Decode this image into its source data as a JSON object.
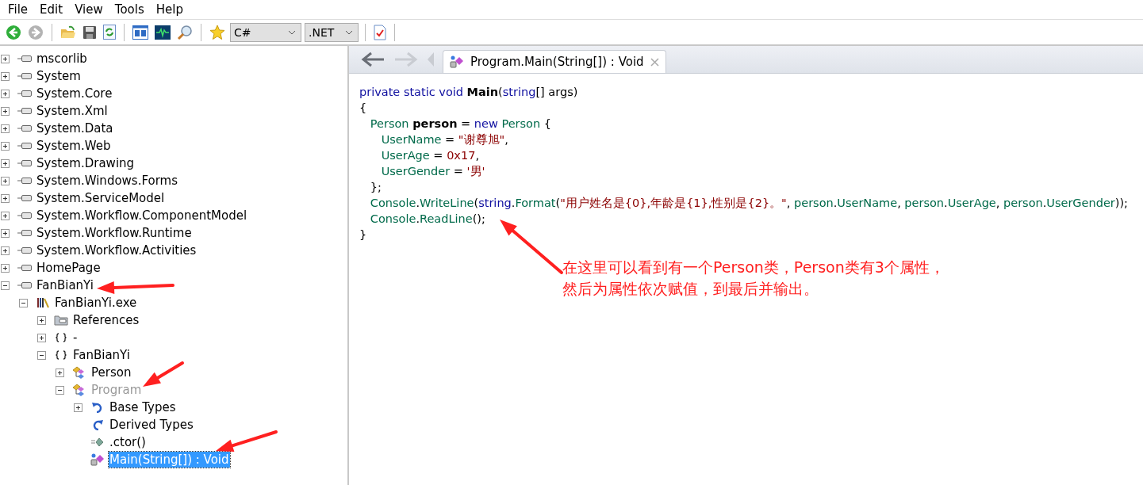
{
  "menu": [
    {
      "label": "File"
    },
    {
      "label": "Edit"
    },
    {
      "label": "View"
    },
    {
      "label": "Tools"
    },
    {
      "label": "Help"
    }
  ],
  "toolbar": {
    "buttons": [
      {
        "kind": "back",
        "disabled": false
      },
      {
        "kind": "forward",
        "disabled": true
      },
      {
        "kind": "sep"
      },
      {
        "kind": "open",
        "disabled": false
      },
      {
        "kind": "save",
        "disabled": false
      },
      {
        "kind": "reload",
        "disabled": false
      },
      {
        "kind": "sep"
      },
      {
        "kind": "text",
        "disabled": false
      },
      {
        "kind": "ildasm",
        "disabled": false
      },
      {
        "kind": "search",
        "disabled": false
      },
      {
        "kind": "sep"
      },
      {
        "kind": "favorite",
        "disabled": false
      }
    ],
    "language": "C#",
    "version": ".NET",
    "after": [
      {
        "kind": "sep"
      },
      {
        "kind": "check",
        "disabled": false
      },
      {
        "kind": "sep"
      }
    ]
  },
  "tree": [
    {
      "label": "mscorlib",
      "kind": "assembly",
      "expanded": false,
      "selected": false,
      "greyed": false
    },
    {
      "label": "System",
      "kind": "assembly",
      "expanded": false,
      "selected": false,
      "greyed": false
    },
    {
      "label": "System.Core",
      "kind": "assembly",
      "expanded": false,
      "selected": false,
      "greyed": false
    },
    {
      "label": "System.Xml",
      "kind": "assembly",
      "expanded": false,
      "selected": false,
      "greyed": false
    },
    {
      "label": "System.Data",
      "kind": "assembly",
      "expanded": false,
      "selected": false,
      "greyed": false
    },
    {
      "label": "System.Web",
      "kind": "assembly",
      "expanded": false,
      "selected": false,
      "greyed": false
    },
    {
      "label": "System.Drawing",
      "kind": "assembly",
      "expanded": false,
      "selected": false,
      "greyed": false
    },
    {
      "label": "System.Windows.Forms",
      "kind": "assembly",
      "expanded": false,
      "selected": false,
      "greyed": false
    },
    {
      "label": "System.ServiceModel",
      "kind": "assembly",
      "expanded": false,
      "selected": false,
      "greyed": false
    },
    {
      "label": "System.Workflow.ComponentModel",
      "kind": "assembly",
      "expanded": false,
      "selected": false,
      "greyed": false
    },
    {
      "label": "System.Workflow.Runtime",
      "kind": "assembly",
      "expanded": false,
      "selected": false,
      "greyed": false
    },
    {
      "label": "System.Workflow.Activities",
      "kind": "assembly",
      "expanded": false,
      "selected": false,
      "greyed": false
    },
    {
      "label": "HomePage",
      "kind": "assembly",
      "expanded": false,
      "selected": false,
      "greyed": false
    },
    {
      "label": "FanBianYi",
      "kind": "assembly",
      "expanded": true,
      "selected": false,
      "greyed": false,
      "children": [
        {
          "label": "FanBianYi.exe",
          "kind": "module",
          "expanded": true,
          "selected": false,
          "greyed": false,
          "children": [
            {
              "label": "References",
              "kind": "references",
              "expanded": false,
              "selected": false,
              "greyed": false
            },
            {
              "label": "-",
              "kind": "namespace",
              "expanded": false,
              "selected": false,
              "greyed": false
            },
            {
              "label": "FanBianYi",
              "kind": "namespace",
              "expanded": true,
              "selected": false,
              "greyed": false,
              "children": [
                {
                  "label": "Person",
                  "kind": "class",
                  "expanded": false,
                  "selected": false,
                  "greyed": false
                },
                {
                  "label": "Program",
                  "kind": "class",
                  "expanded": true,
                  "selected": false,
                  "greyed": true,
                  "children": [
                    {
                      "label": "Base Types",
                      "kind": "basetypes",
                      "expanded": false,
                      "selected": false,
                      "greyed": false
                    },
                    {
                      "label": "Derived Types",
                      "kind": "derivedtypes",
                      "selected": false,
                      "greyed": false
                    },
                    {
                      "label": ".ctor()",
                      "kind": "constructor",
                      "selected": false,
                      "greyed": false
                    },
                    {
                      "label": "Main(String[]) : Void",
                      "kind": "method",
                      "selected": true,
                      "greyed": false
                    }
                  ]
                }
              ]
            }
          ]
        }
      ]
    }
  ],
  "nav": {
    "back_disabled": false,
    "forward_disabled": true
  },
  "tabs": [
    {
      "title": "Program.Main(String[]) : Void",
      "selected": true
    }
  ],
  "code": [
    [
      {
        "text": "private static void ",
        "kind": "keyword"
      },
      {
        "text": "Main",
        "kind": "bold"
      },
      {
        "text": "(",
        "kind": "plain"
      },
      {
        "text": "string",
        "kind": "keyword"
      },
      {
        "text": "[] args)",
        "kind": "plain"
      }
    ],
    [
      {
        "text": "{",
        "kind": "plain"
      }
    ],
    [
      {
        "text": "   Person ",
        "kind": "type"
      },
      {
        "text": "person",
        "kind": "bold"
      },
      {
        "text": " = ",
        "kind": "plain"
      },
      {
        "text": "new ",
        "kind": "keyword"
      },
      {
        "text": "Person",
        "kind": "type"
      },
      {
        "text": " {",
        "kind": "plain"
      }
    ],
    [
      {
        "text": "      UserName",
        "kind": "type"
      },
      {
        "text": " = ",
        "kind": "plain"
      },
      {
        "text": "\"谢尊旭\"",
        "kind": "string"
      },
      {
        "text": ",",
        "kind": "plain"
      }
    ],
    [
      {
        "text": "      UserAge",
        "kind": "type"
      },
      {
        "text": " = ",
        "kind": "plain"
      },
      {
        "text": "0x17",
        "kind": "string"
      },
      {
        "text": ",",
        "kind": "plain"
      }
    ],
    [
      {
        "text": "      UserGender",
        "kind": "type"
      },
      {
        "text": " = ",
        "kind": "plain"
      },
      {
        "text": "'男'",
        "kind": "string"
      }
    ],
    [
      {
        "text": "   };",
        "kind": "plain"
      }
    ],
    [
      {
        "text": "   Console",
        "kind": "type"
      },
      {
        "text": ".",
        "kind": "plain"
      },
      {
        "text": "WriteLine",
        "kind": "type"
      },
      {
        "text": "(",
        "kind": "plain"
      },
      {
        "text": "string",
        "kind": "keyword"
      },
      {
        "text": ".",
        "kind": "plain"
      },
      {
        "text": "Format",
        "kind": "type"
      },
      {
        "text": "(",
        "kind": "plain"
      },
      {
        "text": "\"用户姓名是{0},年龄是{1},性别是{2}。\"",
        "kind": "string"
      },
      {
        "text": ", ",
        "kind": "plain"
      },
      {
        "text": "person",
        "kind": "type"
      },
      {
        "text": ".",
        "kind": "plain"
      },
      {
        "text": "UserName",
        "kind": "type"
      },
      {
        "text": ", ",
        "kind": "plain"
      },
      {
        "text": "person",
        "kind": "type"
      },
      {
        "text": ".",
        "kind": "plain"
      },
      {
        "text": "UserAge",
        "kind": "type"
      },
      {
        "text": ", ",
        "kind": "plain"
      },
      {
        "text": "person",
        "kind": "type"
      },
      {
        "text": ".",
        "kind": "plain"
      },
      {
        "text": "UserGender",
        "kind": "type"
      },
      {
        "text": "));",
        "kind": "plain"
      }
    ],
    [
      {
        "text": "   Console",
        "kind": "type"
      },
      {
        "text": ".",
        "kind": "plain"
      },
      {
        "text": "ReadLine",
        "kind": "type"
      },
      {
        "text": "();",
        "kind": "plain"
      }
    ],
    [
      {
        "text": "}",
        "kind": "plain"
      }
    ]
  ],
  "annotation": {
    "lines": [
      "在这里可以看到有一个Person类，Person类有3个属性，",
      "然后为属性依次赋值，到最后并输出。"
    ],
    "color": "#ff2020"
  }
}
